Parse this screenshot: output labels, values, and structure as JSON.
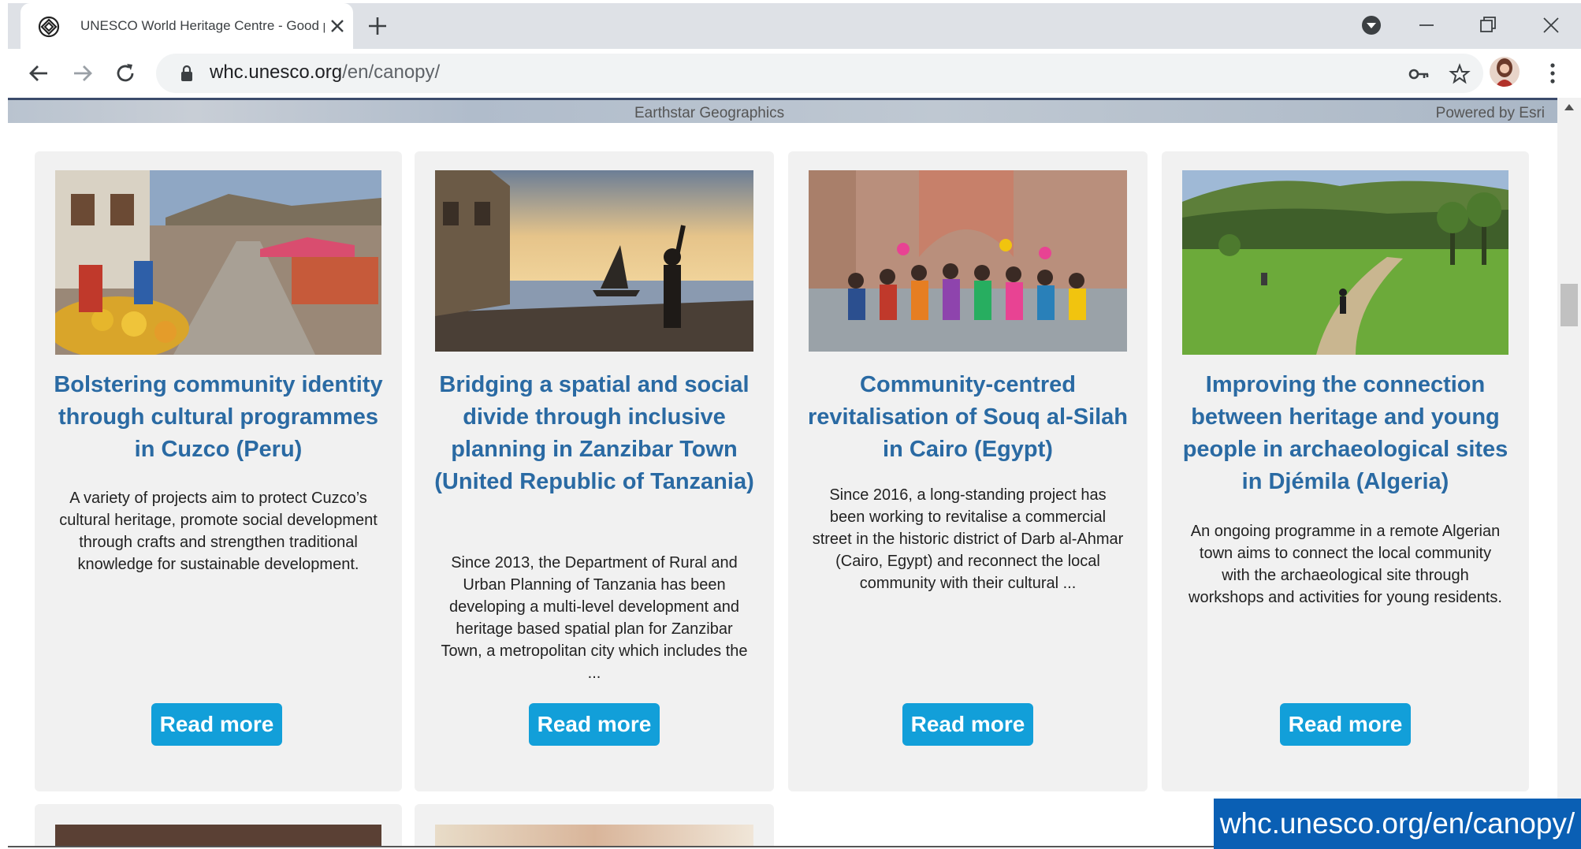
{
  "browser": {
    "tab_title": "UNESCO World Heritage Centre - Good prac",
    "url_domain": "whc.unesco.org",
    "url_path": "/en/canopy/"
  },
  "map": {
    "attribution_left": "Earthstar Geographics",
    "attribution_right": "Powered by Esri"
  },
  "cards": [
    {
      "title": "Bolstering community identity through cultural programmes in Cuzco (Peru)",
      "description": "A variety of projects aim to protect Cuzco’s cultural heritage, promote social development through crafts and strengthen traditional knowledge for sustainable development.",
      "button": "Read more"
    },
    {
      "title": "Bridging a spatial and social divide through inclusive planning in Zanzibar Town (United Republic of Tanzania)",
      "description": "Since 2013, the Department of Rural and Urban Planning of Tanzania has been developing a multi-level development and heritage based spatial plan for Zanzibar Town, a metropolitan city which includes the ...",
      "button": "Read more"
    },
    {
      "title": "Community-centred revitalisation of Souq al-Silah in Cairo (Egypt)",
      "description": "Since 2016, a long-standing project has been working to revitalise a commercial street in the historic district of Darb al-Ahmar (Cairo, Egypt) and reconnect the local community with their cultural ...",
      "button": "Read more"
    },
    {
      "title": "Improving the connection between heritage and young people in archaeological sites in Djémila (Algeria)",
      "description": "An ongoing programme in a remote Algerian town aims to connect the local community with the archaeological site through workshops and activities for young residents.",
      "button": "Read more"
    }
  ],
  "overlay": {
    "url_text": "whc.unesco.org/en/canopy/"
  },
  "colors": {
    "title_blue": "#2a6aa3",
    "button_blue": "#129fd9",
    "overlay_blue": "#0a5fb4"
  }
}
